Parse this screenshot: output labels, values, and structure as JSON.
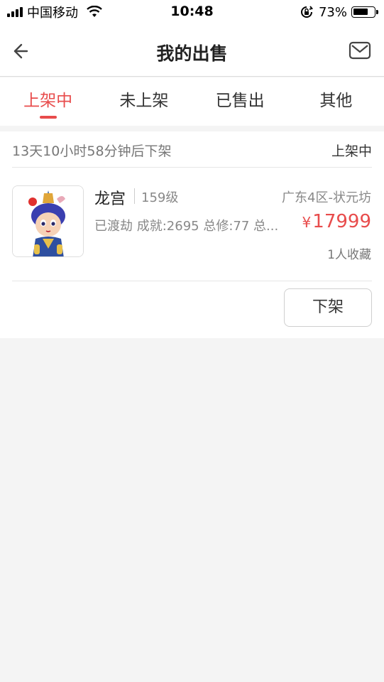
{
  "status_bar": {
    "carrier": "中国移动",
    "time": "10:48",
    "battery_percent": "73%",
    "battery_level": 0.73
  },
  "nav": {
    "title": "我的出售",
    "back_icon": "back-arrow-icon",
    "mail_icon": "mail-icon"
  },
  "tabs": [
    {
      "label": "上架中",
      "active": true
    },
    {
      "label": "未上架",
      "active": false
    },
    {
      "label": "已售出",
      "active": false
    },
    {
      "label": "其他",
      "active": false
    }
  ],
  "listing": {
    "offshelf_time": "13天10小时58分钟后下架",
    "status": "上架中",
    "name": "龙宫",
    "level": "159级",
    "server": "广东4区-状元坊",
    "description": "已渡劫 成就:2695 总修:77 总...",
    "currency": "¥",
    "price": "17999",
    "favorites": "1人收藏",
    "offshelf_button": "下架"
  },
  "colors": {
    "accent": "#e84c4c",
    "background": "#f4f4f4"
  }
}
